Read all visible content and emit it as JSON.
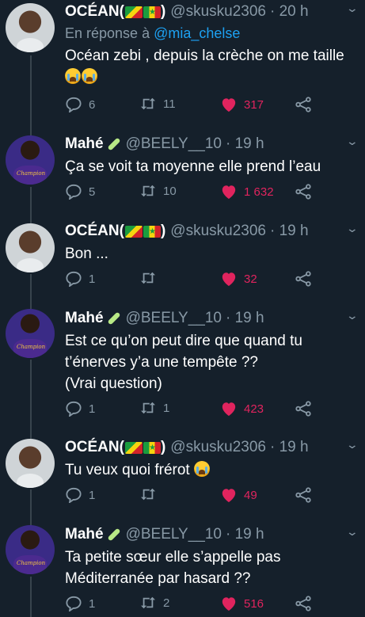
{
  "tweets": [
    {
      "author": "ocean",
      "name": "OCÉAN(",
      "name_close": ")",
      "handle": "@skusku2306",
      "time": "· 20 h",
      "reply_prefix": "En réponse à",
      "reply_to": "@mia_chelse",
      "text": "Océan zebi , depuis la crèche on me taille",
      "emoji_count": 2,
      "replies": "6",
      "retweets": "11",
      "likes": "317"
    },
    {
      "author": "mahe",
      "name": "Mahé",
      "handle": "@BEELY__10",
      "time": "· 19 h",
      "text": "Ça se voit ta moyenne elle prend l’eau",
      "replies": "5",
      "retweets": "10",
      "likes": "1 632"
    },
    {
      "author": "ocean",
      "name": "OCÉAN(",
      "name_close": ")",
      "handle": "@skusku2306",
      "time": "· 19 h",
      "text": "Bon ...",
      "replies": "1",
      "retweets": "",
      "likes": "32"
    },
    {
      "author": "mahe",
      "name": "Mahé",
      "handle": "@BEELY__10",
      "time": "· 19 h",
      "text_lines": [
        "Est ce qu’on peut dire que quand tu",
        "t’énerves y’a une tempête ??",
        "(Vrai question)"
      ],
      "replies": "1",
      "retweets": "1",
      "likes": "423"
    },
    {
      "author": "ocean",
      "name": "OCÉAN(",
      "name_close": ")",
      "handle": "@skusku2306",
      "time": "· 19 h",
      "text": "Tu veux quoi frérot",
      "emoji_count": 1,
      "replies": "1",
      "retweets": "",
      "likes": "49"
    },
    {
      "author": "mahe",
      "name": "Mahé",
      "handle": "@BEELY__10",
      "time": "· 19 h",
      "text_lines": [
        "Ta petite sœur elle s’appelle pas",
        "Méditerranée par hasard ??"
      ],
      "replies": "1",
      "retweets": "2",
      "likes": "516"
    }
  ],
  "avatar_jersey_text": "Champion",
  "icons": {
    "reply": "reply-icon",
    "retweet": "retweet-icon",
    "like": "heart-icon",
    "share": "share-icon",
    "more": "chevron-down-icon"
  },
  "colors": {
    "background": "#15202b",
    "secondary_text": "#8899a6",
    "link": "#1da1f2",
    "like": "#e0245e",
    "thread_line": "#38444d"
  }
}
